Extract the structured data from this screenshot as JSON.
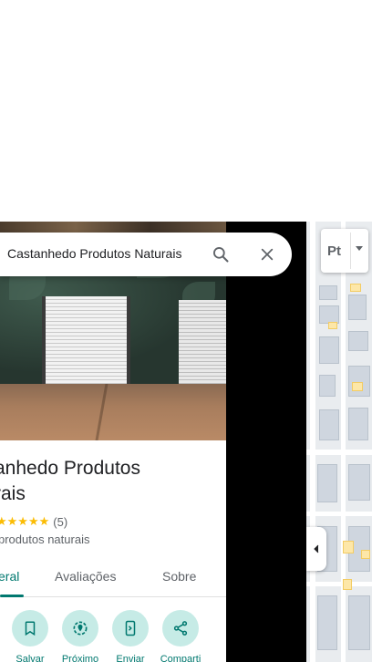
{
  "search": {
    "query": "Castanhedo Produtos Naturais"
  },
  "place": {
    "name": "anhedo Produtos\nrais",
    "name_line1": "anhedo Produtos",
    "name_line2": "rais",
    "stars": "★★★★★",
    "rating_value": 5,
    "review_count": "(5)",
    "category": "produtos naturais"
  },
  "tabs": [
    {
      "label": "eral",
      "active": true
    },
    {
      "label": "Avaliações",
      "active": false
    },
    {
      "label": "Sobre",
      "active": false
    }
  ],
  "actions": [
    {
      "label": "Salvar",
      "icon": "bookmark-icon"
    },
    {
      "label": "Próximo",
      "icon": "nearby-icon"
    },
    {
      "label": "Enviar",
      "icon": "send-to-phone-icon"
    },
    {
      "label": "Comparti",
      "icon": "share-icon"
    }
  ],
  "map": {
    "language_label": "Pt"
  },
  "colors": {
    "accent": "#00786f",
    "action_bg": "#c6ebe6",
    "star": "#fbbc04",
    "map_bg": "#e9ecef"
  }
}
